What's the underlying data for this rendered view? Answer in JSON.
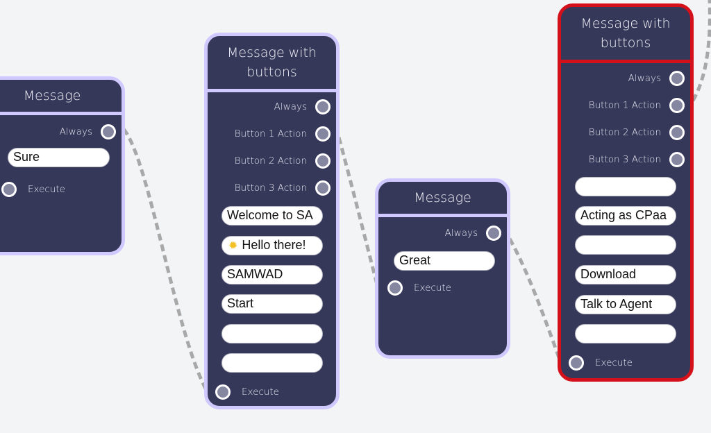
{
  "canvas": {
    "background": "#f3f4f6",
    "node_fill": "#363859",
    "node_border": "#cfc9ff",
    "selected_border": "#d4101b",
    "connector_color": "#a8a8a8"
  },
  "nodes": [
    {
      "id": "node-1",
      "title": "Message",
      "selected": false,
      "outputs": [
        "Always"
      ],
      "fields": [
        "Sure"
      ],
      "input_label": "Execute"
    },
    {
      "id": "node-2",
      "title": "Message with buttons",
      "selected": false,
      "outputs": [
        "Always",
        "Button 1 Action",
        "Button 2 Action",
        "Button 3 Action"
      ],
      "fields": [
        "Welcome to SA",
        "Hello there!",
        "SAMWAD",
        "Start",
        "",
        ""
      ],
      "field_icons": {
        "1": "sparkle-star-icon"
      },
      "input_label": "Execute"
    },
    {
      "id": "node-3",
      "title": "Message",
      "selected": false,
      "outputs": [
        "Always"
      ],
      "fields": [
        "Great"
      ],
      "input_label": "Execute"
    },
    {
      "id": "node-4",
      "title": "Message with buttons",
      "selected": true,
      "outputs": [
        "Always",
        "Button 1 Action",
        "Button 2 Action",
        "Button 3 Action"
      ],
      "fields": [
        "",
        "Acting as CPaa",
        "",
        "Download",
        "Talk to Agent",
        ""
      ],
      "input_label": "Execute"
    }
  ],
  "connections": [
    {
      "from": "node-1.Always",
      "to": "node-2.Execute"
    },
    {
      "from": "node-2.Button 1 Action",
      "to": "node-3.Execute"
    },
    {
      "from": "node-3.Always",
      "to": "node-4.Execute"
    },
    {
      "from": "node-4.Button 1 Action",
      "to": "offscreen"
    }
  ]
}
